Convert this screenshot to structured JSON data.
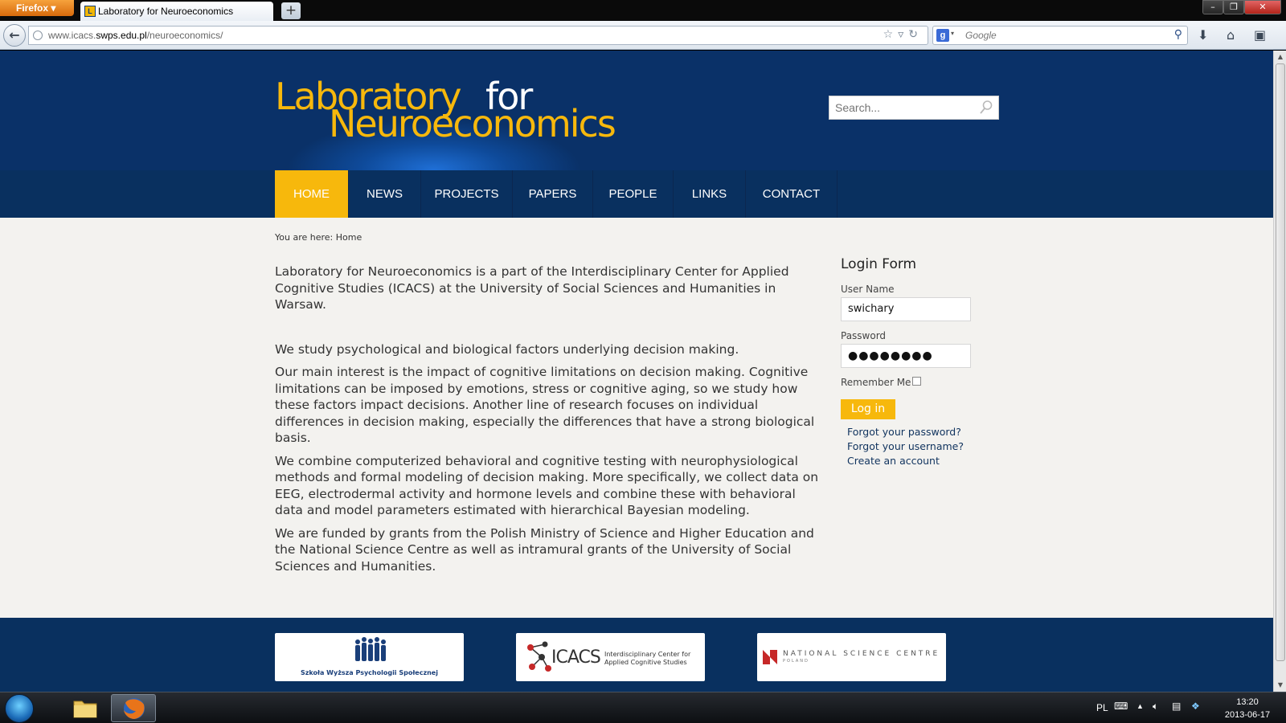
{
  "browser": {
    "menu_label": "Firefox",
    "tab_title": "Laboratory for Neuroeconomics",
    "url_prefix": "www.icacs.",
    "url_domain": "swps.edu.pl",
    "url_path": "/neuroeconomics/",
    "search_engine_placeholder": "Google"
  },
  "site": {
    "logo_line1": "Laboratory",
    "logo_for": "for",
    "logo_line2": "Neuroeconomics",
    "search_placeholder": "Search..."
  },
  "menu": [
    {
      "label": "HOME",
      "active": true
    },
    {
      "label": "NEWS"
    },
    {
      "label": "PROJECTS"
    },
    {
      "label": "PAPERS"
    },
    {
      "label": "PEOPLE"
    },
    {
      "label": "LINKS"
    },
    {
      "label": "CONTACT"
    }
  ],
  "breadcrumb": {
    "prefix": "You are here:",
    "current": "Home"
  },
  "content": {
    "paragraphs": [
      "Laboratory for Neuroeconomics is a part of the Interdisciplinary Center for Applied Cognitive Studies (ICACS) at the University of Social Sciences and Humanities in Warsaw.",
      "We study psychological and biological factors underlying decision making.",
      "Our main interest is the impact of cognitive limitations on decision making. Cognitive limitations can be imposed by emotions, stress or cognitive aging, so we study how these factors impact decisions. Another line of research focuses on individual differences in decision making, especially the differences that have a strong biological basis.",
      "We combine computerized behavioral and cognitive testing with neurophysiological methods and formal modeling of decision making. More specifically, we collect data on EEG, electrodermal activity and hormone levels and combine these with behavioral data and model parameters estimated with hierarchical Bayesian modeling.",
      "We are funded by grants from the Polish Ministry of Science and Higher Education and the National Science Centre as well as intramural grants of the University of Social Sciences and Humanities."
    ]
  },
  "login": {
    "title": "Login Form",
    "username_label": "User Name",
    "username_value": "swichary",
    "password_label": "Password",
    "password_value": "●●●●●●●●",
    "remember_label": "Remember Me",
    "remember_checked": false,
    "button_label": "Log in",
    "links": [
      "Forgot your password?",
      "Forgot your username?",
      "Create an account"
    ]
  },
  "footer": {
    "sponsors": [
      {
        "label": "Szkoła Wyższa Psychologii Społecznej"
      },
      {
        "label": "ICACS",
        "subtitle": "Interdisciplinary Center for Applied Cognitive Studies"
      },
      {
        "label": "NATIONAL SCIENCE CENTRE",
        "subtitle": "POLAND"
      }
    ]
  },
  "taskbar": {
    "language": "PL",
    "time": "13:20",
    "date": "2013-06-17"
  },
  "colors": {
    "header_blue": "#0a3168",
    "accent_yellow": "#f7b80c",
    "menu_blue": "#09305f",
    "page_bg": "#f3f2ef",
    "link_blue": "#10335e"
  }
}
